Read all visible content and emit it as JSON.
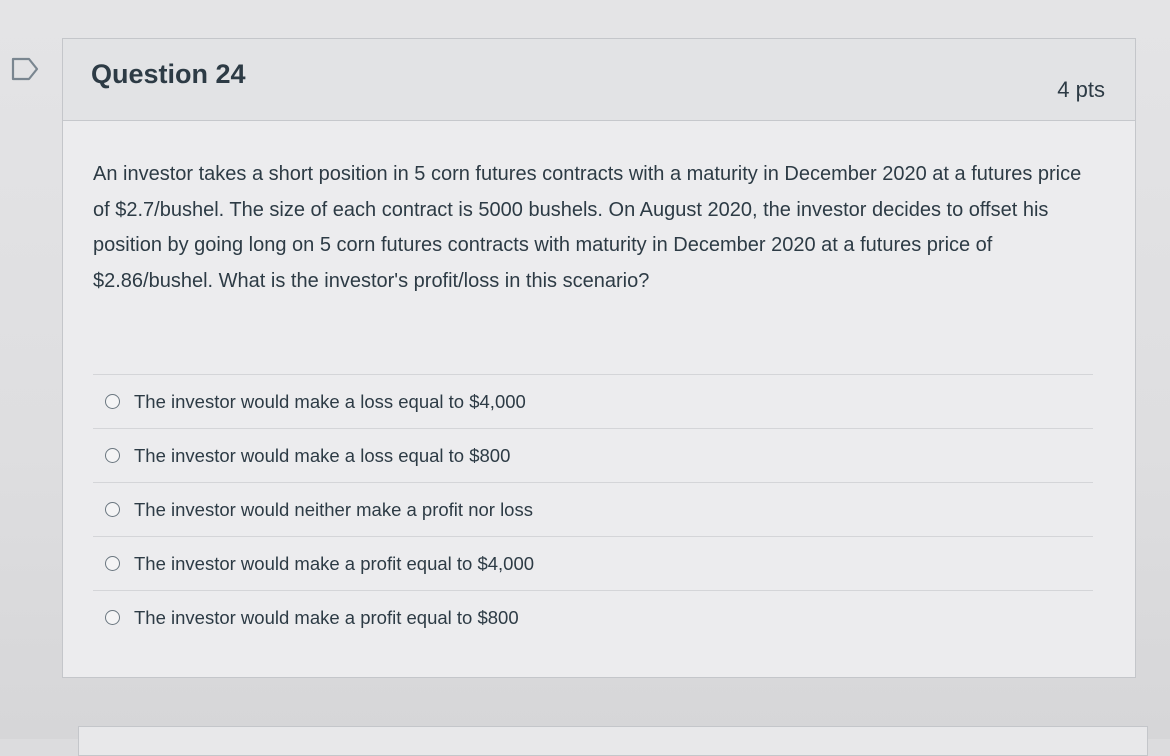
{
  "question": {
    "title": "Question 24",
    "points": "4 pts",
    "body": "An investor takes a short position in 5 corn futures contracts with a maturity in December 2020 at a futures price of $2.7/bushel. The size of each contract is 5000 bushels. On August 2020, the investor decides to offset his position by going long on 5 corn futures contracts with maturity in December 2020 at a futures price of $2.86/bushel. What is the investor's profit/loss in this scenario?",
    "answers": [
      {
        "label": "The investor would make a loss equal to $4,000",
        "selected": false
      },
      {
        "label": "The investor would make a loss equal to $800",
        "selected": false
      },
      {
        "label": "The investor would neither make a profit nor loss",
        "selected": false
      },
      {
        "label": "The investor would make a profit equal to $4,000",
        "selected": false
      },
      {
        "label": "The investor would make a profit equal to $800",
        "selected": false
      }
    ]
  },
  "icons": {
    "flag": "flag-outline-icon"
  },
  "colors": {
    "text": "#2d3b45",
    "header_bg": "#e2e3e5",
    "card_border": "#c4c6ca"
  }
}
